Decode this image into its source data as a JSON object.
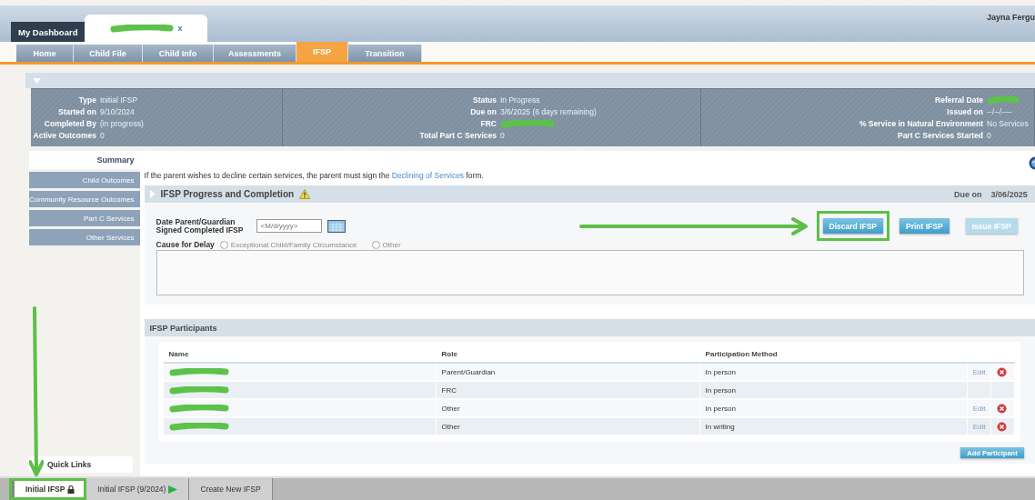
{
  "header": {
    "tabs": [
      {
        "kind": "text",
        "label": "My Dashboard",
        "selected": false
      },
      {
        "kind": "redacted",
        "close": "x",
        "selected": true
      }
    ],
    "user": "Jayna Fergu"
  },
  "nav": [
    {
      "label": "Home",
      "selected": false
    },
    {
      "label": "Child File",
      "selected": false
    },
    {
      "label": "Child Info",
      "selected": false
    },
    {
      "label": "Assessments",
      "selected": false
    },
    {
      "label": "IFSP",
      "selected": true
    },
    {
      "label": "Transition",
      "selected": false
    }
  ],
  "summary": [
    [
      {
        "label": "Type",
        "value": "Initial IFSP"
      },
      {
        "label": "Started on",
        "value": "9/10/2024"
      },
      {
        "label": "Completed By",
        "value": "(in progress)"
      },
      {
        "label": "Active Outcomes",
        "value": "0"
      }
    ],
    [
      {
        "label": "Status",
        "value": "In Progress"
      },
      {
        "label": "Due on",
        "value": "3/6/2025 (6 days remaining)"
      },
      {
        "label": "FRC",
        "redacted": true
      },
      {
        "label": "Total Part C Services",
        "value": "0"
      }
    ],
    [
      {
        "label": "Referral Date",
        "redacted": true
      },
      {
        "label": "Issued on",
        "value": "--/--/----"
      },
      {
        "label": "% Service in Natural Environment",
        "value": "No Services"
      },
      {
        "label": "Part C Services Started",
        "value": "0"
      }
    ]
  ],
  "sidebar": [
    {
      "label": "Summary",
      "selected": true
    },
    {
      "label": "Child Outcomes",
      "selected": false
    },
    {
      "label": "Community Resource Outcomes",
      "selected": false
    },
    {
      "label": "Part C Services",
      "selected": false
    },
    {
      "label": "Other Services",
      "selected": false
    }
  ],
  "quick_links": "Quick Links",
  "notice": {
    "before": "If the parent wishes to decline certain services, the parent must sign the",
    "link": "Declining of Services",
    "after": "form."
  },
  "progress": {
    "title": "IFSP Progress and Completion",
    "due_label": "Due on",
    "due_value": "3/06/2025",
    "date_label": "Date Parent/Guardian Signed Completed IFSP",
    "date_placeholder": "<M/d/yyyy>",
    "delay_label": "Cause for Delay",
    "delay_options": [
      {
        "label": "Exceptional Child/Family Circumstance",
        "selected": false,
        "disabled": true
      },
      {
        "label": "Other",
        "selected": false,
        "disabled": true
      }
    ],
    "buttons": [
      {
        "label": "Discard IFSP",
        "disabled": false,
        "highlighted": true
      },
      {
        "label": "Print IFSP",
        "disabled": false,
        "highlighted": false
      },
      {
        "label": "Issue IFSP",
        "disabled": true,
        "highlighted": false
      }
    ]
  },
  "participants": {
    "title": "IFSP Participants",
    "columns": [
      "Name",
      "Role",
      "Participation Method"
    ],
    "rows": [
      {
        "role": "Parent/Guardian",
        "method": "In person",
        "edit": "Edit",
        "removable": true
      },
      {
        "role": "FRC",
        "method": "In person",
        "removable": false
      },
      {
        "role": "Other",
        "method": "In person",
        "edit": "Edit",
        "removable": true
      },
      {
        "role": "Other",
        "method": "In writing",
        "edit": "Edit",
        "removable": true
      }
    ],
    "add": "Add Participant"
  },
  "bottom_tabs": [
    {
      "label": "Initial IFSP",
      "kind": "locked",
      "selected": true,
      "highlighted": true
    },
    {
      "label": "Initial IFSP (9/2024)",
      "kind": "current",
      "selected": false,
      "highlighted": false
    },
    {
      "label": "Create New IFSP",
      "kind": "plain",
      "selected": false,
      "highlighted": false
    }
  ]
}
